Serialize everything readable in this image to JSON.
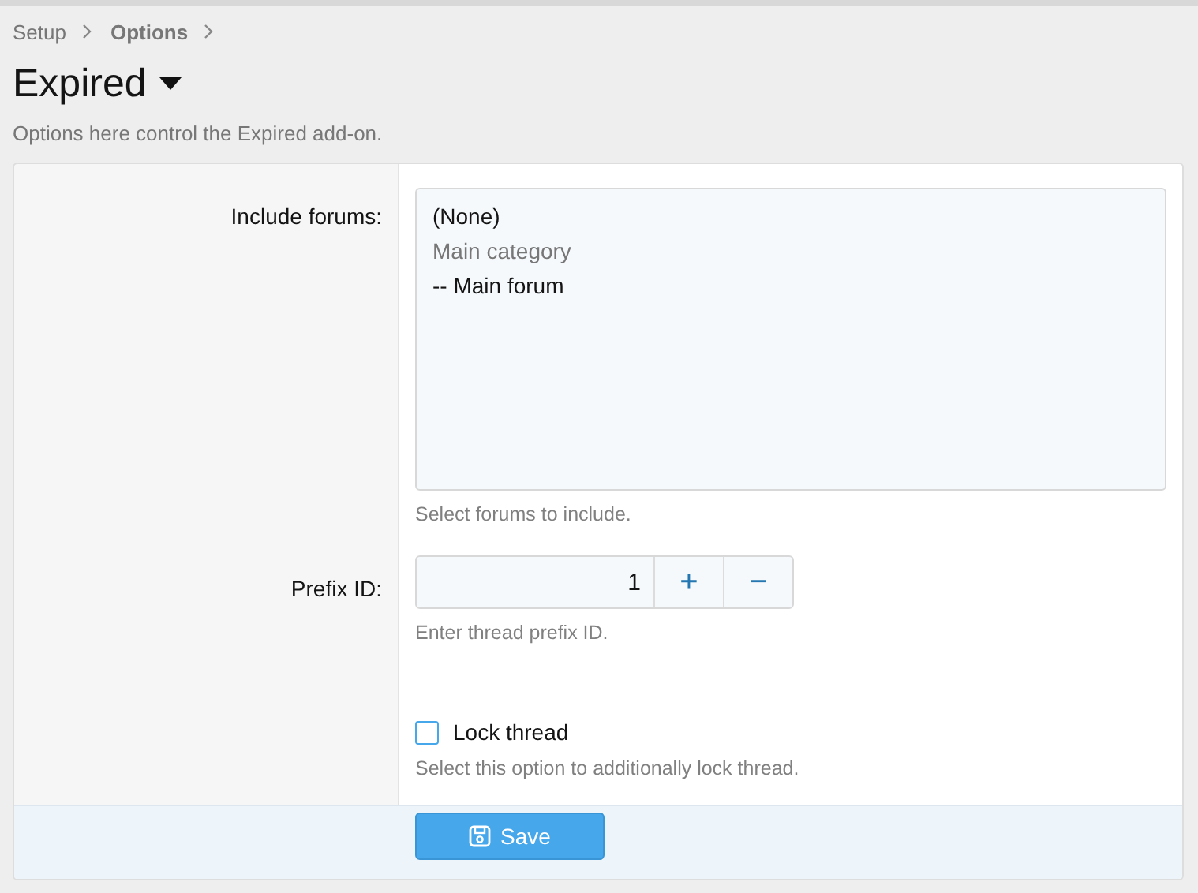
{
  "breadcrumb": [
    {
      "label": "Setup",
      "bold": false
    },
    {
      "label": "Options",
      "bold": true
    }
  ],
  "title": "Expired",
  "description": "Options here control the Expired add-on.",
  "fields": [
    {
      "kind": "listbox",
      "label": "Include forums:",
      "options": [
        {
          "label": "(None)",
          "kind": "option"
        },
        {
          "label": "Main category",
          "kind": "category"
        },
        {
          "label": "-- Main forum",
          "kind": "option"
        }
      ],
      "hint": "Select forums to include."
    },
    {
      "kind": "number",
      "label": "Prefix ID:",
      "value": "1",
      "increment": "+",
      "decrement": "−",
      "hint": "Enter thread prefix ID."
    },
    {
      "kind": "checkbox",
      "label": "Lock thread",
      "checked": false,
      "hint": "Select this option to additionally lock thread."
    }
  ],
  "save_button": "Save"
}
